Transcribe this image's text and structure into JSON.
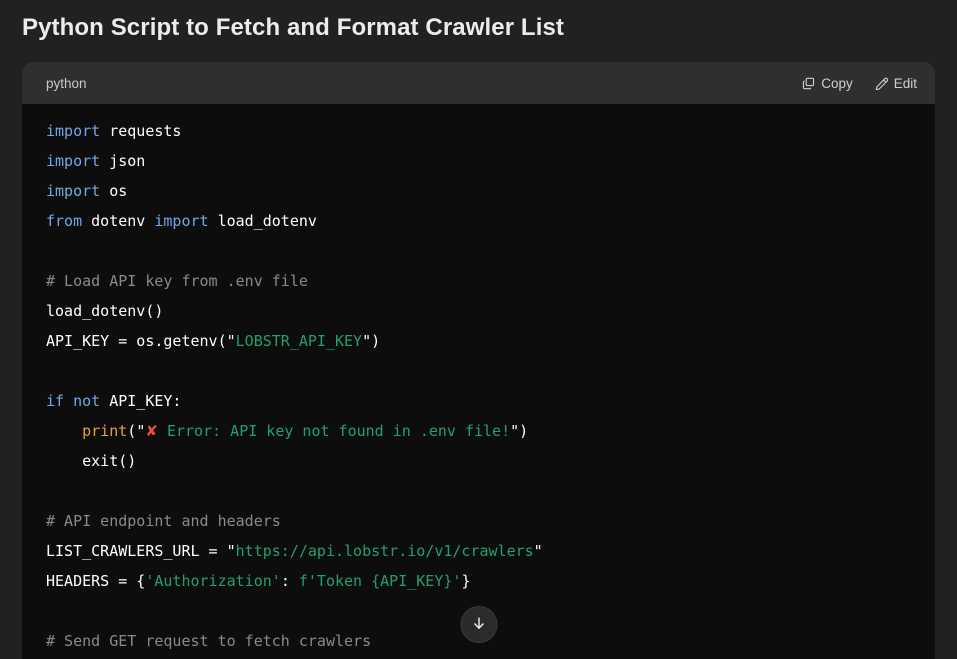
{
  "page": {
    "title": "Python Script to Fetch and Format Crawler List",
    "background_color": "#212121"
  },
  "code_block": {
    "language_label": "python",
    "header_background": "#2f2f2f",
    "body_background": "#0d0d0d",
    "actions": [
      {
        "label": "Copy",
        "icon": "copy-icon"
      },
      {
        "label": "Edit",
        "icon": "pencil-icon"
      }
    ],
    "scroll_button": {
      "icon": "arrow-down-icon",
      "label": "Scroll to bottom"
    },
    "syntax_colors": {
      "keyword": "#6fa8e6",
      "function": "#e0a33c",
      "string": "#23a06a",
      "comment": "#8a8a8a",
      "plain": "#ffffff",
      "emoji_error": "#e8503a"
    },
    "code_lines": [
      "import requests",
      "import json",
      "import os",
      "from dotenv import load_dotenv",
      "",
      "# Load API key from .env file",
      "load_dotenv()",
      "API_KEY = os.getenv(\"LOBSTR_API_KEY\")",
      "",
      "if not API_KEY:",
      "    print(\"❌ Error: API key not found in .env file!\")",
      "    exit()",
      "",
      "# API endpoint and headers",
      "LIST_CRAWLERS_URL = \"https://api.lobstr.io/v1/crawlers\"",
      "HEADERS = {'Authorization': f'Token {API_KEY}'}",
      "",
      "# Send GET request to fetch crawlers"
    ]
  }
}
